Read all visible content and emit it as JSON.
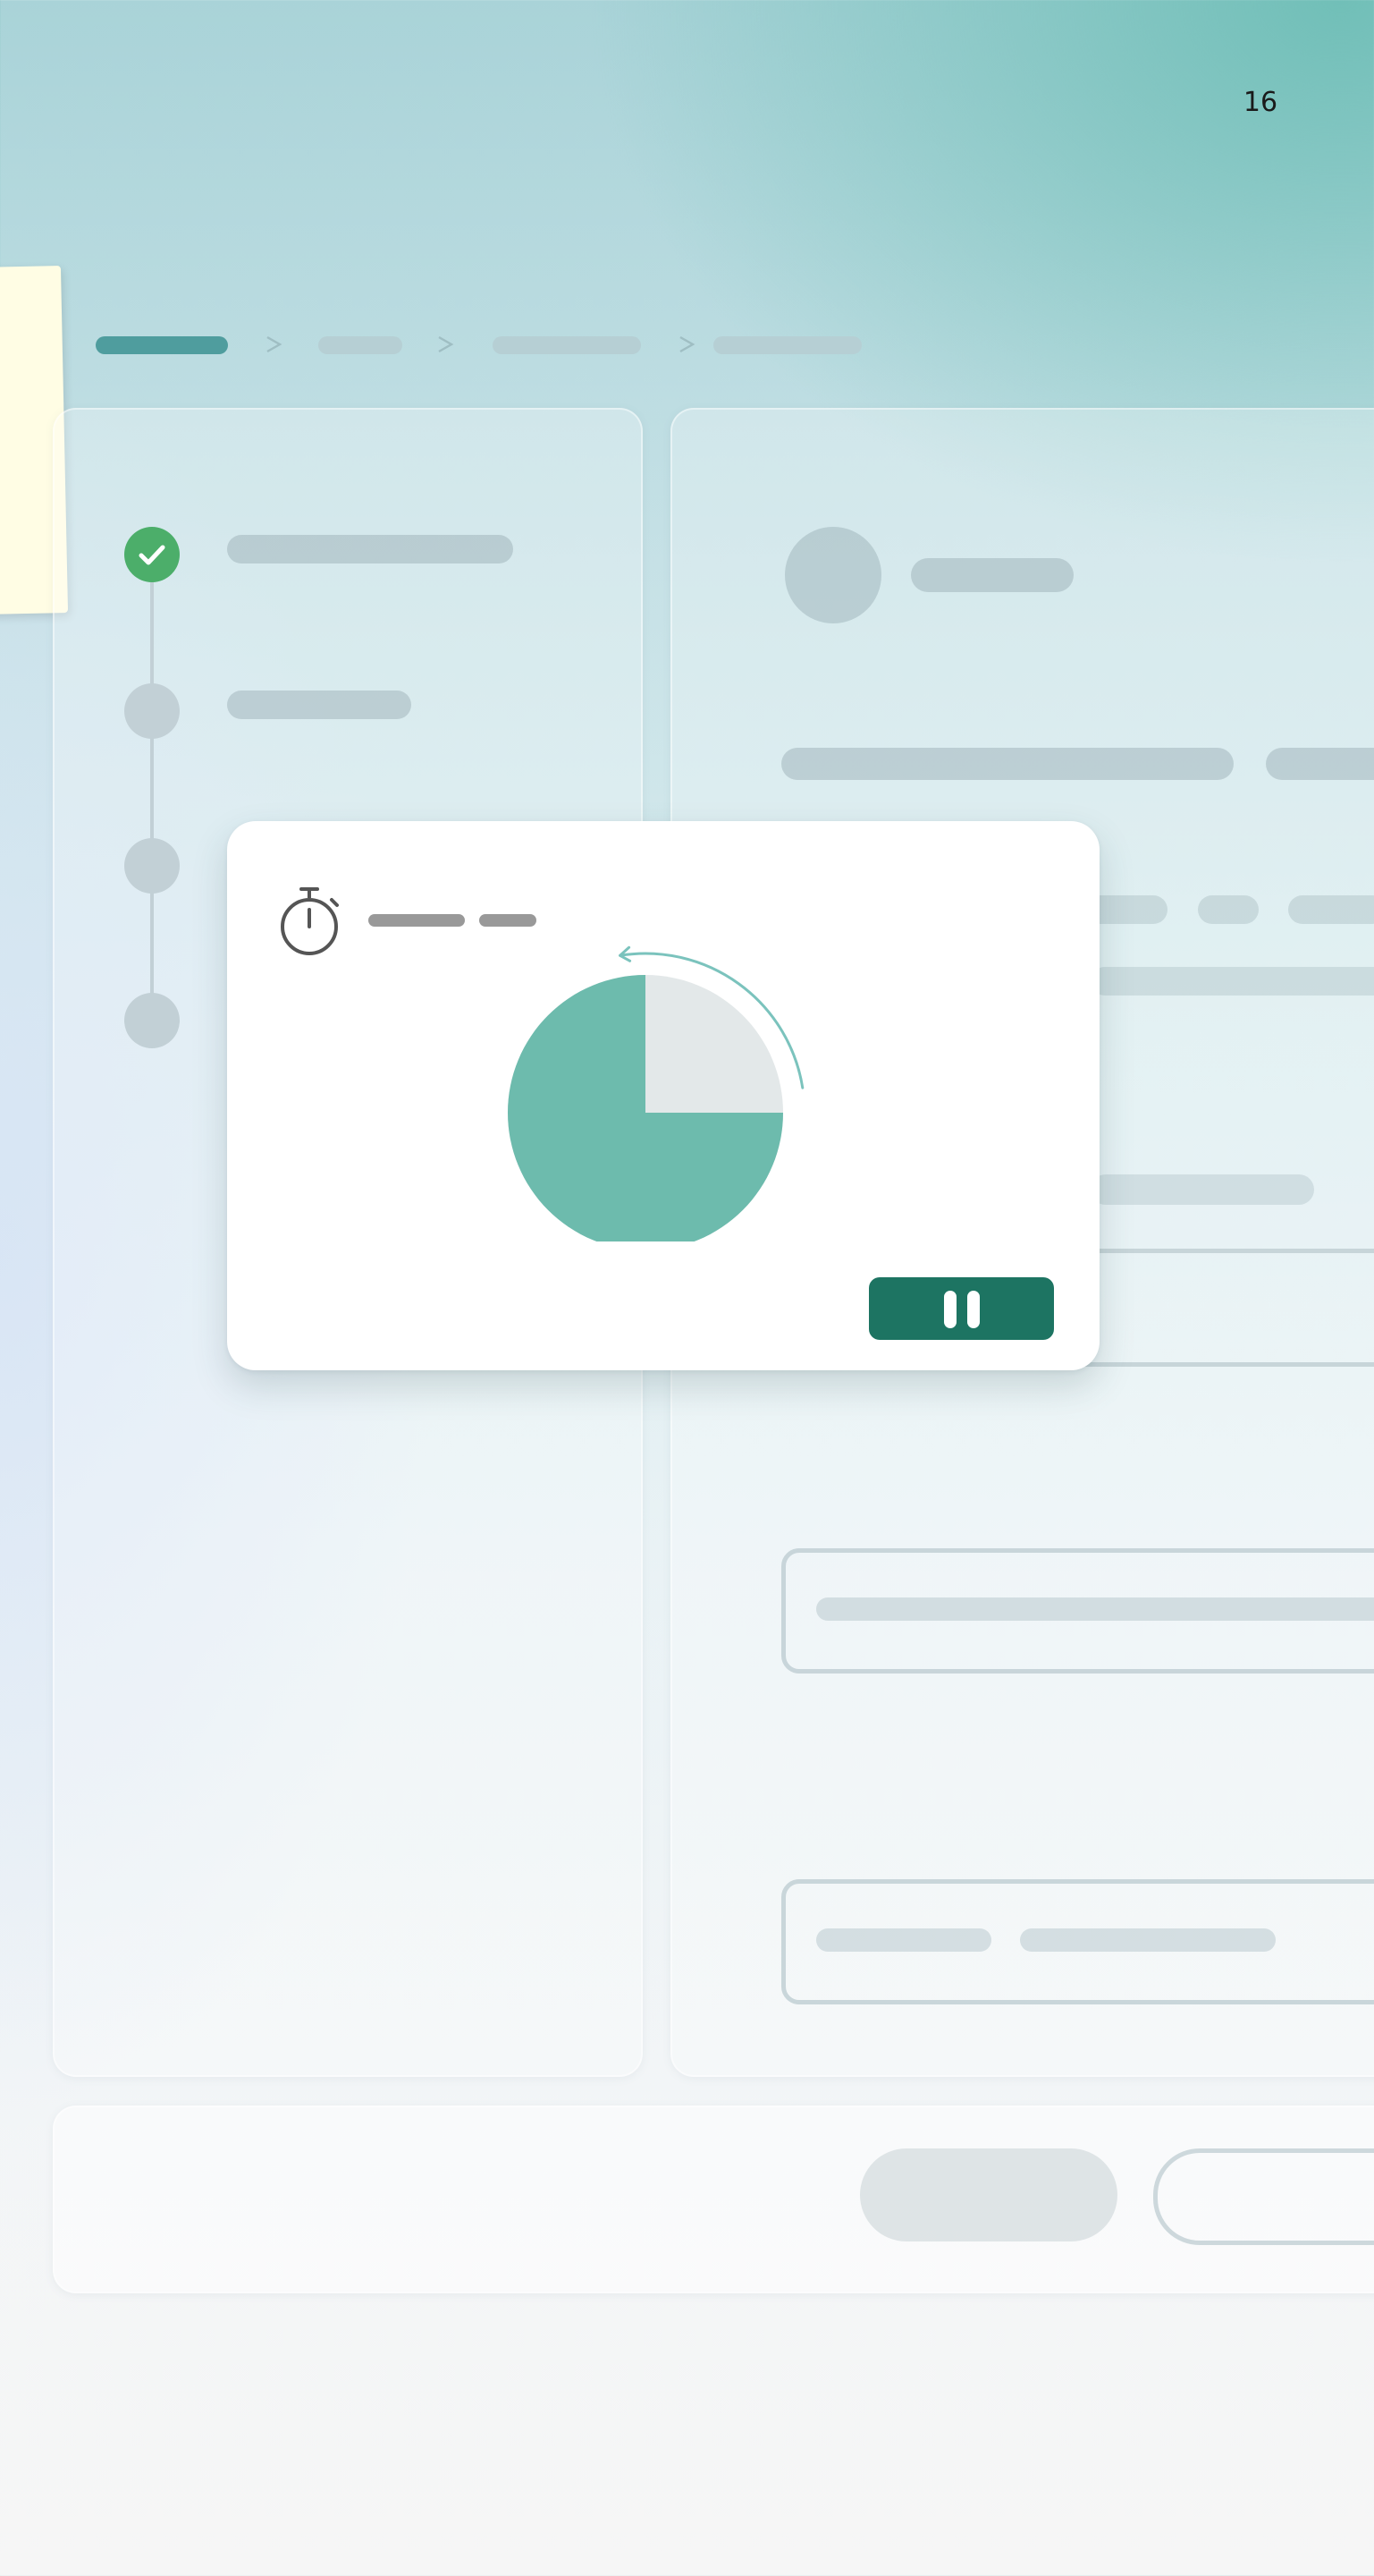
{
  "page": {
    "number": "16"
  },
  "breadcrumb": {
    "steps": 4,
    "active_step": 1
  },
  "stepper": {
    "steps": 4,
    "completed_steps": 1
  },
  "timer": {
    "elapsed_fraction": 0.75,
    "state": "running"
  },
  "colors": {
    "accent": "#1d7462",
    "pie_fill": "#6dbbad",
    "pie_remaining": "#e3e8e9",
    "step_done": "#4cae6a",
    "note": "#fffde4"
  },
  "icons": {
    "timer": "stopwatch-icon",
    "pause": "pause-icon",
    "step_done": "check-icon",
    "breadcrumb_separator": "chevron-right-icon",
    "countdown": "counterclockwise-arrow-icon"
  }
}
